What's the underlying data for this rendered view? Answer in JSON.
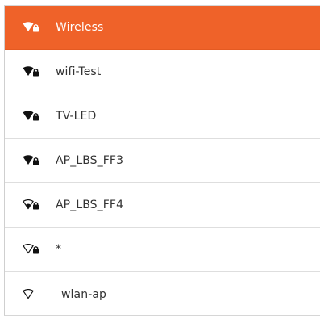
{
  "colors": {
    "selected_bg": "#ef6229",
    "selected_text": "#ffffff",
    "text": "#333333",
    "divider": "#dedede"
  },
  "networks": [
    {
      "name": "Wireless",
      "icon": "wifi-full-secured-icon",
      "selected": true
    },
    {
      "name": "wifi-Test",
      "icon": "wifi-full-secured-icon",
      "selected": false
    },
    {
      "name": "TV-LED",
      "icon": "wifi-full-secured-icon",
      "selected": false
    },
    {
      "name": "AP_LBS_FF3",
      "icon": "wifi-full-secured-icon",
      "selected": false
    },
    {
      "name": "AP_LBS_FF4",
      "icon": "wifi-weak-secured-icon",
      "selected": false
    },
    {
      "name": "*",
      "icon": "wifi-empty-secured-icon",
      "selected": false
    },
    {
      "name": "wlan-ap",
      "icon": "wifi-empty-open-icon",
      "selected": false
    }
  ]
}
